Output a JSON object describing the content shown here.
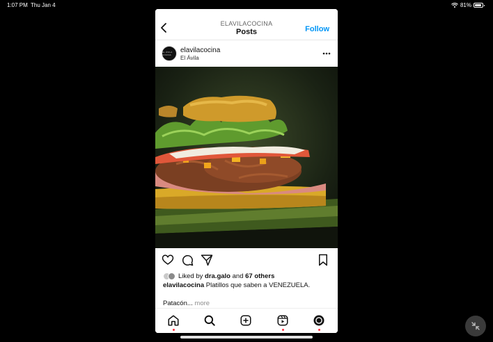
{
  "status_bar": {
    "time": "1:07 PM",
    "date": "Thu Jan 4",
    "battery": "81%"
  },
  "header": {
    "username": "ELAVILACOCINA",
    "title": "Posts",
    "follow_label": "Follow"
  },
  "post": {
    "username": "elavilacocina",
    "location": "El Ávila",
    "avatar_text": "EL ÁVILA COCINA",
    "likes": {
      "prefix": "Liked by ",
      "first_liker": "dra.galo",
      "connector": " and ",
      "others": "67 others"
    },
    "caption": {
      "username": "elavilacocina",
      "text": " Platillos que saben a VENEZUELA.",
      "line2": "Patacón...",
      "more_label": " more"
    }
  },
  "icons": {
    "back": "chevron-left-icon",
    "more": "more-horizontal-icon",
    "like": "heart-icon",
    "comment": "comment-icon",
    "share": "send-icon",
    "save": "bookmark-icon",
    "home": "home-icon",
    "search": "search-icon",
    "create": "plus-square-icon",
    "reels": "reels-icon",
    "profile": "profile-icon"
  },
  "colors": {
    "accent": "#0095f6",
    "notification_dot": "#ff3040"
  }
}
